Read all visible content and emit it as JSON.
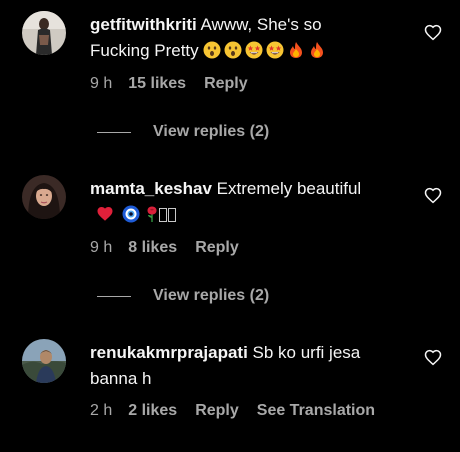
{
  "comments": [
    {
      "username": "getfitwithkriti",
      "text_line1": " Awww, She's so",
      "text_line2": "Fucking Pretty ",
      "emojis": [
        "astonished-face",
        "astonished-face",
        "star-struck-face",
        "star-struck-face",
        "fire",
        "fire"
      ],
      "time": "9 h",
      "likes": "15 likes",
      "reply": "Reply",
      "view_replies": "View replies (2)"
    },
    {
      "username": "mamta_keshav",
      "text_line1": " Extremely beautiful",
      "emojis": [
        "red-heart",
        "nazar-amulet",
        "rose",
        "missing-glyph",
        "missing-glyph"
      ],
      "time": "9 h",
      "likes": "8 likes",
      "reply": "Reply",
      "view_replies": "View replies (2)"
    },
    {
      "username": "renukakmrprajapati",
      "text_line1": " Sb ko urfi jesa",
      "text_line2": "banna h",
      "time": "2 h",
      "likes": "2 likes",
      "reply": "Reply",
      "translate": "See Translation"
    }
  ],
  "colors": {
    "background": "#000000",
    "primary_text": "#f5f5f5",
    "secondary_text": "#a8a8a8"
  }
}
